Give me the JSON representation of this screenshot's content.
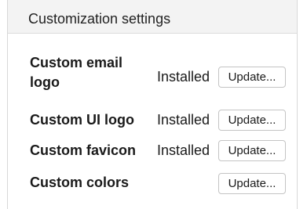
{
  "header": {
    "title": "Customization settings"
  },
  "settings": [
    {
      "label_line1": "Custom email",
      "label_line2": "logo",
      "status": "Installed",
      "button": "Update..."
    },
    {
      "label": "Custom UI logo",
      "status": "Installed",
      "button": "Update..."
    },
    {
      "label": "Custom favicon",
      "status": "Installed",
      "button": "Update..."
    },
    {
      "label": "Custom colors",
      "status": "",
      "button": "Update..."
    }
  ]
}
